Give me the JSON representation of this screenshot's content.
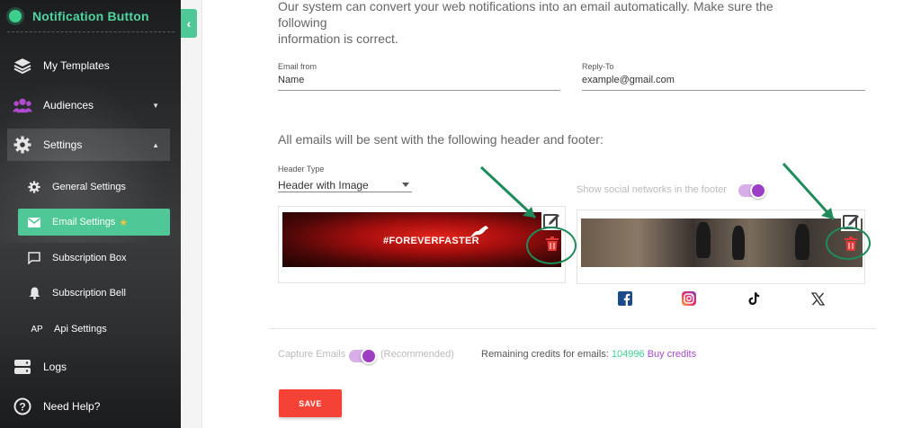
{
  "sidebar": {
    "brand": "Notification Button",
    "items": [
      {
        "label": "My Templates",
        "icon": "layers-icon"
      },
      {
        "label": "Audiences",
        "icon": "users-icon"
      },
      {
        "label": "Settings",
        "icon": "gear-icon"
      }
    ],
    "sub_items": [
      {
        "label": "General Settings",
        "icon": "gear-icon"
      },
      {
        "label": "Email Settings",
        "icon": "email-icon"
      },
      {
        "label": "Subscription Box",
        "icon": "chat-box-icon"
      },
      {
        "label": "Subscription Bell",
        "icon": "bell-icon"
      },
      {
        "label": "Api Settings",
        "prefix": "AP"
      }
    ],
    "bottom_items": [
      {
        "label": "Logs",
        "icon": "server-icon"
      },
      {
        "label": "Need Help?",
        "icon": "help-icon"
      }
    ]
  },
  "main": {
    "intro_line1": "Our system can convert your web notifications into an email automatically. Make sure the following",
    "intro_line2": "information is correct.",
    "email_from": {
      "label": "Email from",
      "value": "Name"
    },
    "reply_to": {
      "label": "Reply-To",
      "value": "example@gmail.com"
    },
    "section_title": "All emails will be sent with the following header and footer:",
    "header_type": {
      "label": "Header Type",
      "value": "Header with Image"
    },
    "show_social_label": "Show social networks in the footer",
    "header_banner_text": "#FOREVERFASTER",
    "capture_label": "Capture Emails",
    "recommended": "(Recommended)",
    "credits_label": "Remaining credits for emails:",
    "credits_value": "104996",
    "buy_credits": "Buy credits",
    "save_label": "SAVE"
  },
  "colors": {
    "accent": "#4fc796",
    "toggle": "#9c3fc4",
    "save": "#f44336",
    "trash": "#e53935",
    "highlight": "#1f8a5a"
  }
}
